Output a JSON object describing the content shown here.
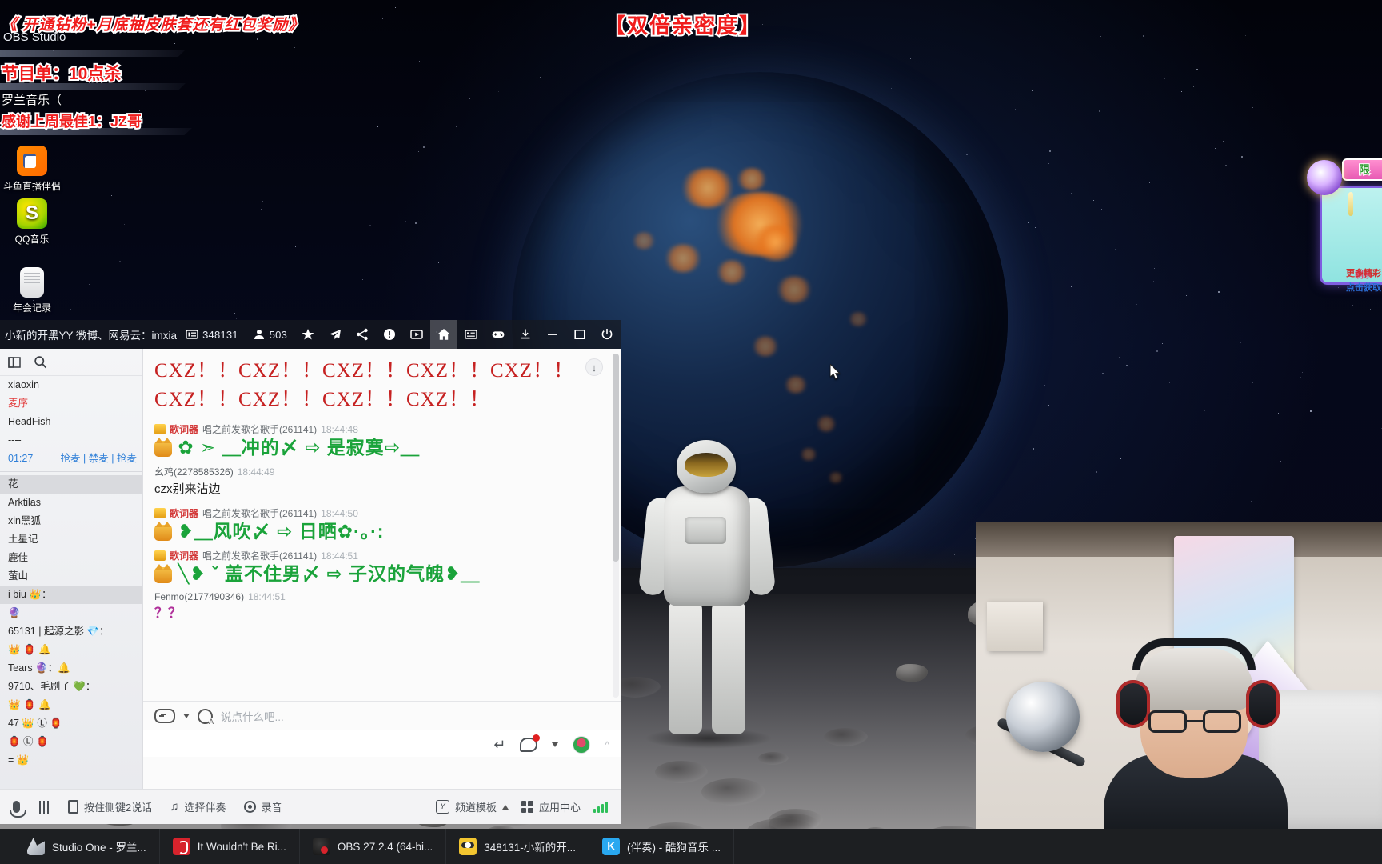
{
  "overlays": {
    "top_banner": "《 开通钻粉+月底抽皮肤套还有红包奖励》",
    "center_banner": "【双倍亲密度】",
    "schedule": "节目单：10点杀",
    "schedule_sub": "罗兰音乐（",
    "thanks": "感谢上周最佳1：JZ哥",
    "obs_label": "OBS Studio"
  },
  "desktop_icons": [
    {
      "name": "斗鱼直播伴侣",
      "icon": "douyu-icon"
    },
    {
      "name": "QQ音乐",
      "icon": "qq-music-icon"
    },
    {
      "name": "年会记录",
      "icon": "document-icon"
    }
  ],
  "gift_widget": {
    "badge": "限",
    "line1": "剩余",
    "line2": "点击获取",
    "line3": "更多精彩"
  },
  "yy_window": {
    "title": "小新的开黑YY 微博、网易云：imxia...",
    "room_id": "348131",
    "online_count": "503",
    "titlebar_icons": [
      "id-card-icon",
      "people-icon",
      "star-icon",
      "plane-icon",
      "share-icon",
      "shield-icon",
      "video-icon",
      "home-icon",
      "list-icon",
      "gamepad-icon",
      "download-icon",
      "minimize-icon",
      "maximize-icon",
      "power-icon"
    ],
    "sidebar": {
      "tool_icons": [
        "window-icon",
        "search-icon"
      ],
      "rows": [
        {
          "text": "xiaoxin",
          "style": "plain"
        },
        {
          "text": "麦序",
          "style": "red"
        },
        {
          "text": "HeadFish",
          "style": "plain"
        },
        {
          "text": "----",
          "style": "muted"
        },
        {
          "text": "01:27",
          "style": "mic",
          "actions": [
            "抢麦",
            "禁麦",
            "抢麦"
          ]
        },
        {
          "text": "花",
          "style": "sel"
        },
        {
          "text": "Arktilas",
          "style": "plain"
        },
        {
          "text": "xin黑狐",
          "style": "plain"
        },
        {
          "text": "土星记",
          "style": "plain"
        },
        {
          "text": "鹿佳",
          "style": "plain"
        },
        {
          "text": "萤山",
          "style": "plain"
        },
        {
          "text": "i biu 👑：",
          "style": "sel"
        },
        {
          "text": "🔮",
          "style": "plain"
        },
        {
          "text": "65131 | 起源之影 💎：",
          "style": "plain"
        },
        {
          "text": "👑 🏮 🔔",
          "style": "plain"
        },
        {
          "text": "Tears 🔮：🔔",
          "style": "plain"
        },
        {
          "text": "9710、毛刷子 💚：",
          "style": "plain"
        },
        {
          "text": "👑 🏮 🔔",
          "style": "plain"
        },
        {
          "text": "47 👑 Ⓛ 🏮",
          "style": "plain"
        },
        {
          "text": "🏮 Ⓛ 🏮",
          "style": "plain"
        },
        {
          "text": "= 👑",
          "style": "plain"
        }
      ]
    },
    "chat": {
      "banner_line1": "CXZ！！CXZ！！CXZ！！CXZ！！CXZ！！",
      "banner_line2": "CXZ！！CXZ！！CXZ！！CXZ！！",
      "messages": [
        {
          "badge": "crown",
          "nick_red": "歌词器",
          "nick_rest": "唱之前发歌名歌手(261141)",
          "time": "18:44:48",
          "body": "✿ ➣ ＿冲的〆 ⇨ 是寂寞⇨＿",
          "type": "lyric"
        },
        {
          "badge": "none",
          "nick_red": "",
          "nick_rest": "幺鸡(2278585326)",
          "time": "18:44:49",
          "body": "czx别来沾边",
          "type": "plain"
        },
        {
          "badge": "crown",
          "nick_red": "歌词器",
          "nick_rest": "唱之前发歌名歌手(261141)",
          "time": "18:44:50",
          "body": "❥＿风吹〆 ⇨ 日晒✿·。·:",
          "type": "lyric"
        },
        {
          "badge": "crown",
          "nick_red": "歌词器",
          "nick_rest": "唱之前发歌名歌手(261141)",
          "time": "18:44:51",
          "body": "╲❥ ˇ 盖不住男〆 ⇨ 子汉的气魄❥＿",
          "type": "lyric"
        },
        {
          "badge": "none",
          "nick_red": "",
          "nick_rest": "Fenmo(2177490346)",
          "time": "18:44:51",
          "body": "？？",
          "type": "question"
        }
      ],
      "input_placeholder": "说点什么吧...",
      "scroll_to_bottom": "↓"
    },
    "bottom_bar": {
      "left": [
        {
          "label": "",
          "icon": "microphone-icon"
        },
        {
          "label": "",
          "icon": "equalizer-icon"
        },
        {
          "label": "按住侧键2说话",
          "icon": "key-icon"
        },
        {
          "label": "选择伴奏",
          "icon": "music-note-icon"
        },
        {
          "label": "录音",
          "icon": "record-icon"
        }
      ],
      "right": [
        {
          "label": "频道模板",
          "icon": "y-icon"
        },
        {
          "label": "应用中心",
          "icon": "grid-icon"
        },
        {
          "label": "",
          "icon": "signal-icon"
        }
      ]
    }
  },
  "taskbar": {
    "apps": [
      {
        "label": "Studio One - 罗兰...",
        "icon": "studio-one-icon"
      },
      {
        "label": "It Wouldn't Be Ri...",
        "icon": "netease-music-icon"
      },
      {
        "label": "OBS 27.2.4 (64-bi...",
        "icon": "obs-icon"
      },
      {
        "label": "348131-小新的开...",
        "icon": "yy-icon"
      },
      {
        "label": "(伴奏) - 酷狗音乐 ...",
        "icon": "kugou-icon"
      }
    ]
  },
  "colors": {
    "accent_red": "#c62121",
    "lyric_green": "#1aa33a",
    "link_blue": "#2f7fd8",
    "overlay_red": "#f01c1c"
  }
}
